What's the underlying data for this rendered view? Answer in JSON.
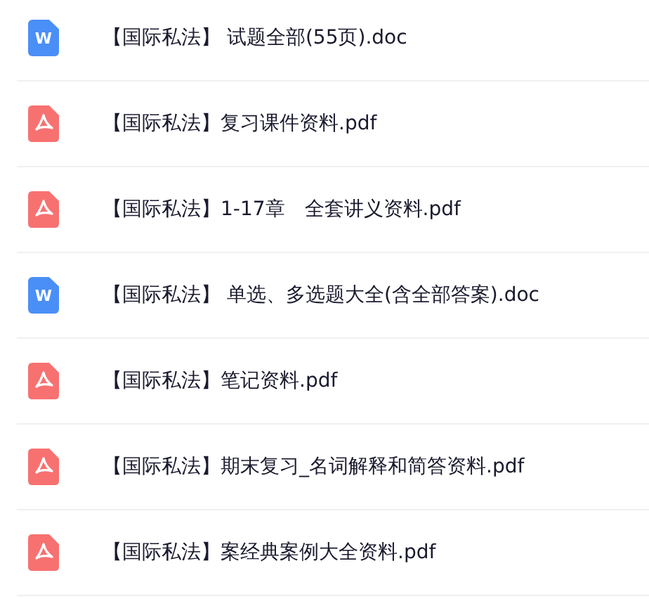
{
  "files": [
    {
      "kind": "doc",
      "icon_letter": "W",
      "name": "【国际私法】 试题全部(55页).doc"
    },
    {
      "kind": "pdf",
      "name": "【国际私法】复习课件资料.pdf"
    },
    {
      "kind": "pdf",
      "name": "【国际私法】1-17章　全套讲义资料.pdf"
    },
    {
      "kind": "doc",
      "icon_letter": "W",
      "name": "【国际私法】 单选、多选题大全(含全部答案).doc"
    },
    {
      "kind": "pdf",
      "name": "【国际私法】笔记资料.pdf"
    },
    {
      "kind": "pdf",
      "name": "【国际私法】期末复习_名词解释和简答资料.pdf"
    },
    {
      "kind": "pdf",
      "name": "【国际私法】案经典案例大全资料.pdf"
    }
  ]
}
